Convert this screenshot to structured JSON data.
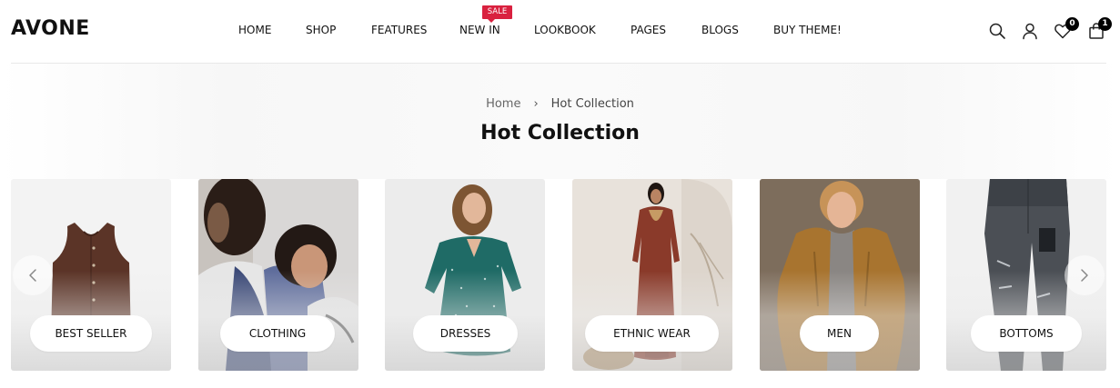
{
  "header": {
    "logo": "AVONE",
    "nav": [
      {
        "label": "HOME"
      },
      {
        "label": "SHOP"
      },
      {
        "label": "FEATURES"
      },
      {
        "label": "NEW IN"
      },
      {
        "label": "LOOKBOOK"
      },
      {
        "label": "PAGES"
      },
      {
        "label": "BLOGS"
      },
      {
        "label": "BUY THEME!"
      }
    ],
    "sale_badge": "SALE",
    "icons": {
      "search": "search-icon",
      "account": "user-icon",
      "wishlist": "heart-icon",
      "cart": "shopping-bag-icon"
    },
    "wishlist_count": "0",
    "cart_count": "1",
    "badge_color": "#d9213f"
  },
  "breadcrumb": {
    "home": "Home",
    "separator": "›",
    "current": "Hot Collection"
  },
  "page_title": "Hot Collection",
  "collections": [
    {
      "label": "BEST SELLER",
      "image": "brown button-front sleeveless vest"
    },
    {
      "label": "CLOTHING",
      "image": "two young people in casual shirts"
    },
    {
      "label": "DRESSES",
      "image": "woman in teal polka dot dress"
    },
    {
      "label": "ETHNIC WEAR",
      "image": "woman in rust embroidered kurta"
    },
    {
      "label": "MEN",
      "image": "young man in tan corduroy jacket"
    },
    {
      "label": "BOTTOMS",
      "image": "grey distressed denim jeans"
    }
  ],
  "carousel": {
    "prev": "chevron-left-icon",
    "next": "chevron-right-icon"
  }
}
